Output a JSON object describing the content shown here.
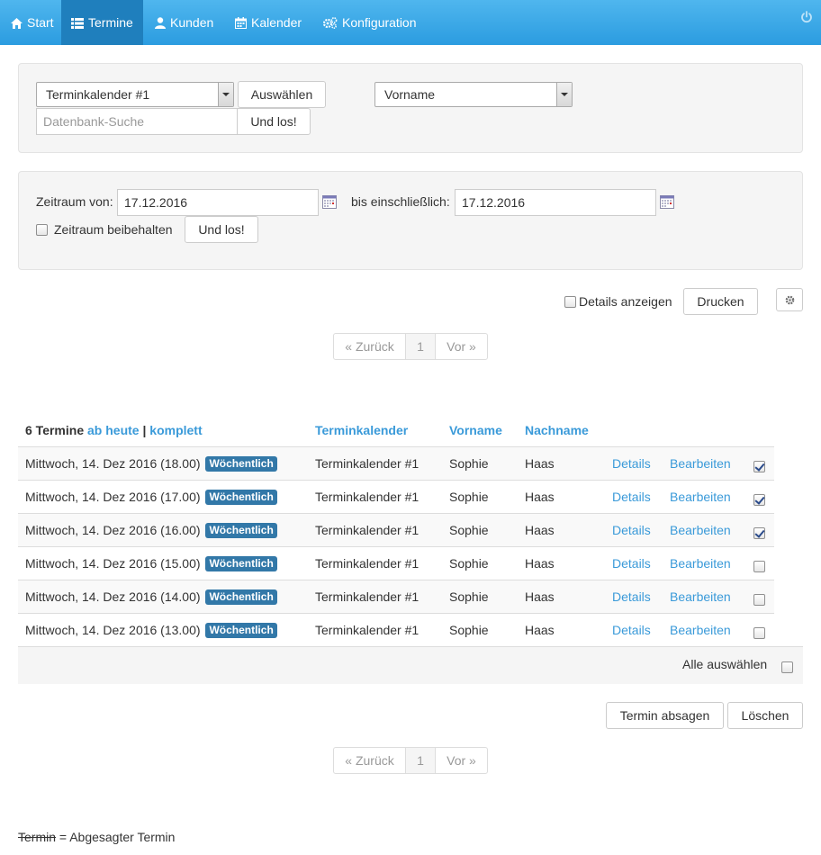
{
  "nav": {
    "items": [
      {
        "label": "Start",
        "icon": "home-icon"
      },
      {
        "label": "Termine",
        "icon": "list-icon"
      },
      {
        "label": "Kunden",
        "icon": "user-icon"
      },
      {
        "label": "Kalender",
        "icon": "calendar-icon"
      },
      {
        "label": "Konfiguration",
        "icon": "gears-icon"
      }
    ],
    "active": "Termine",
    "power_icon": "power-icon"
  },
  "filter": {
    "calendar_select": "Terminkalender #1",
    "select_button": "Auswählen",
    "field_select": "Vorname",
    "search_placeholder": "Datenbank-Suche",
    "search_button": "Und los!"
  },
  "period": {
    "from_label": "Zeitraum von:",
    "from_value": "17.12.2016",
    "to_label": "bis einschließlich:",
    "to_value": "17.12.2016",
    "keep_label": "Zeitraum beibehalten",
    "go_button": "Und los!"
  },
  "toolbar": {
    "details_label": "Details anzeigen",
    "print_button": "Drucken",
    "settings_icon": "gear-icon"
  },
  "pagination": {
    "prev": "« Zurück",
    "page": "1",
    "next": "Vor »"
  },
  "table": {
    "count_label": "6 Termine",
    "link_today": "ab heute",
    "separator": "|",
    "link_all": "komplett",
    "headers": {
      "calendar": "Terminkalender",
      "firstname": "Vorname",
      "lastname": "Nachname"
    },
    "rows": [
      {
        "date": "Mittwoch, 14. Dez 2016 (18.00)",
        "badge": "Wöchentlich",
        "calendar": "Terminkalender #1",
        "firstname": "Sophie",
        "lastname": "Haas",
        "details": "Details",
        "edit": "Bearbeiten",
        "checked": true
      },
      {
        "date": "Mittwoch, 14. Dez 2016 (17.00)",
        "badge": "Wöchentlich",
        "calendar": "Terminkalender #1",
        "firstname": "Sophie",
        "lastname": "Haas",
        "details": "Details",
        "edit": "Bearbeiten",
        "checked": true
      },
      {
        "date": "Mittwoch, 14. Dez 2016 (16.00)",
        "badge": "Wöchentlich",
        "calendar": "Terminkalender #1",
        "firstname": "Sophie",
        "lastname": "Haas",
        "details": "Details",
        "edit": "Bearbeiten",
        "checked": true
      },
      {
        "date": "Mittwoch, 14. Dez 2016 (15.00)",
        "badge": "Wöchentlich",
        "calendar": "Terminkalender #1",
        "firstname": "Sophie",
        "lastname": "Haas",
        "details": "Details",
        "edit": "Bearbeiten",
        "checked": false
      },
      {
        "date": "Mittwoch, 14. Dez 2016 (14.00)",
        "badge": "Wöchentlich",
        "calendar": "Terminkalender #1",
        "firstname": "Sophie",
        "lastname": "Haas",
        "details": "Details",
        "edit": "Bearbeiten",
        "checked": false
      },
      {
        "date": "Mittwoch, 14. Dez 2016 (13.00)",
        "badge": "Wöchentlich",
        "calendar": "Terminkalender #1",
        "firstname": "Sophie",
        "lastname": "Haas",
        "details": "Details",
        "edit": "Bearbeiten",
        "checked": false
      }
    ],
    "select_all_label": "Alle auswählen"
  },
  "actions": {
    "cancel_button": "Termin absagen",
    "delete_button": "Löschen"
  },
  "legend": {
    "struck": "Termin",
    "text": "= Abgesagter Termin"
  },
  "colors": {
    "navbar": "#2b9ce0",
    "nav_active": "#1f7fbd",
    "link": "#3a9ad9",
    "badge": "#3278a8"
  }
}
